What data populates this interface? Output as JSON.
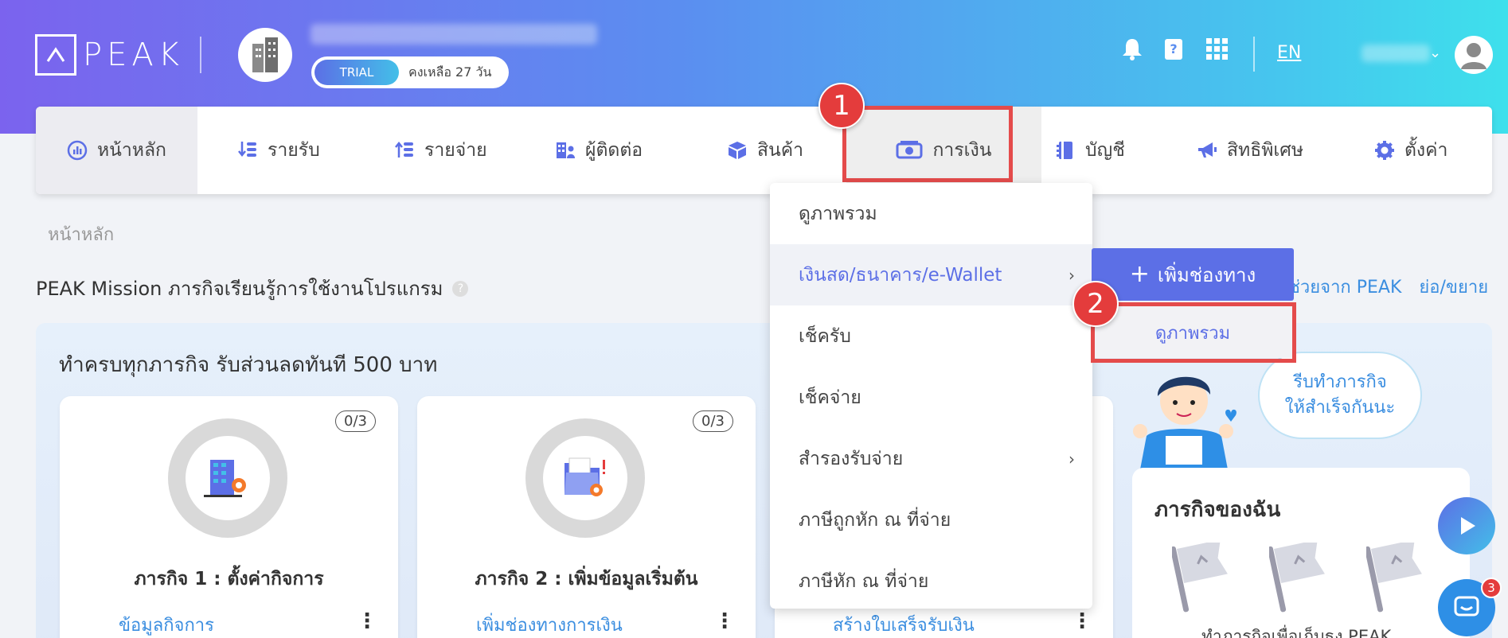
{
  "header": {
    "logo_text": "PEAK",
    "trial_label": "TRIAL",
    "trial_days": "คงเหลือ 27 วัน",
    "language": "EN"
  },
  "nav": {
    "items": [
      {
        "label": "หน้าหลัก",
        "icon": "dashboard-icon"
      },
      {
        "label": "รายรับ",
        "icon": "income-icon"
      },
      {
        "label": "รายจ่าย",
        "icon": "expense-icon"
      },
      {
        "label": "ผู้ติดต่อ",
        "icon": "contacts-icon"
      },
      {
        "label": "สินค้า",
        "icon": "box-icon"
      },
      {
        "label": "การเงิน",
        "icon": "money-icon"
      },
      {
        "label": "บัญชี",
        "icon": "ledger-icon"
      },
      {
        "label": "สิทธิพิเศษ",
        "icon": "megaphone-icon"
      },
      {
        "label": "ตั้งค่า",
        "icon": "gear-icon"
      }
    ],
    "active": "การเงิน"
  },
  "annotations": {
    "step1": "1",
    "step2": "2"
  },
  "dropdown": {
    "items": [
      {
        "label": "ดูภาพรวม"
      },
      {
        "label": "เงินสด/ธนาคาร/e-Wallet",
        "has_submenu": true
      },
      {
        "label": "เช็ครับ"
      },
      {
        "label": "เช็คจ่าย"
      },
      {
        "label": "สำรองรับจ่าย",
        "has_submenu": true
      },
      {
        "label": "ภาษีถูกหัก ณ ที่จ่าย"
      },
      {
        "label": "ภาษีหัก ณ ที่จ่าย"
      }
    ]
  },
  "submenu": {
    "add_label": "เพิ่มช่องทาง",
    "overview_label": "ดูภาพรวม"
  },
  "page": {
    "breadcrumb": "หน้าหลัก",
    "mission_title": "PEAK Mission ภารกิจเรียนรู้การใช้งานโปรแกรม",
    "help_glyph": "?",
    "link_help": "ช่วยจาก PEAK",
    "link_toggle": "ย่อ/ขยาย",
    "panel_title": "ทำครบทุกภารกิจ รับส่วนลดทันที 500 บาท"
  },
  "cards": [
    {
      "count": "0/3",
      "title": "ภารกิจ 1 : ตั้งค่ากิจการ",
      "link": "ข้อมูลกิจการ"
    },
    {
      "count": "0/3",
      "title": "ภารกิจ 2 : เพิ่มข้อมูลเริ่มต้น",
      "link": "เพิ่มช่องทางการเงิน"
    },
    {
      "count": "",
      "title": "",
      "link": "สร้างใบเสร็จรับเงิน"
    }
  ],
  "speech": {
    "line1": "รีบทำภารกิจ",
    "line2": "ให้สำเร็จกันนะ"
  },
  "my_mission": {
    "title": "ภารกิจของฉัน",
    "text": "ทำภารกิจเพื่อเก็บธง PEAK"
  },
  "chat": {
    "unread": "3"
  },
  "colors": {
    "accent": "#5c6fe6",
    "link": "#3b8ee0",
    "highlight": "#e44b4b"
  }
}
